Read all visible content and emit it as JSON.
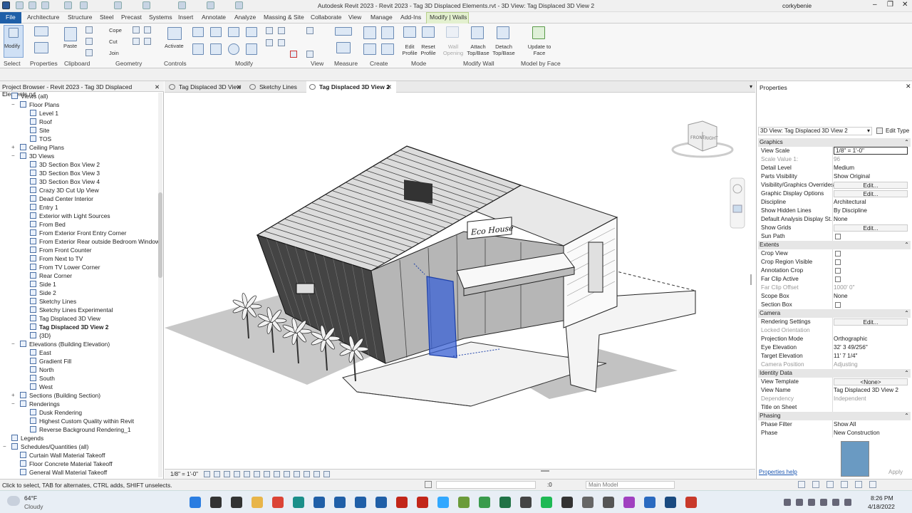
{
  "app": {
    "title": "Autodesk Revit 2023 - Revit 2023 - Tag 3D Displaced Elements.rvt - 3D View: Tag Displaced 3D View 2",
    "user": "corkybenie"
  },
  "ribbon_tabs": [
    "File",
    "Architecture",
    "Structure",
    "Steel",
    "Precast",
    "Systems",
    "Insert",
    "Annotate",
    "Analyze",
    "Massing & Site",
    "Collaborate",
    "View",
    "Manage",
    "Add-Ins",
    "Modify | Walls"
  ],
  "ribbon": {
    "modify": "Modify",
    "paste": "Paste",
    "cope": "Cope",
    "cut": "Cut",
    "join": "Join",
    "activate": "Activate",
    "edit_profile": "Edit Profile",
    "reset_profile": "Reset Profile",
    "wall_opening": "Wall Opening",
    "attach": "Attach Top/Base",
    "detach": "Detach Top/Base",
    "update": "Update to Face",
    "groups": {
      "select": "Select",
      "properties": "Properties",
      "clipboard": "Clipboard",
      "geometry": "Geometry",
      "controls": "Controls",
      "modify": "Modify",
      "view": "View",
      "measure": "Measure",
      "create": "Create",
      "mode": "Mode",
      "modify_wall": "Modify Wall",
      "model_by_face": "Model by Face"
    }
  },
  "project_browser": {
    "title": "Project Browser - Revit 2023 - Tag 3D Displaced Elements.rvt",
    "items": [
      {
        "label": "Views (all)",
        "level": 0,
        "tog": "−"
      },
      {
        "label": "Floor Plans",
        "level": 1,
        "tog": "−"
      },
      {
        "label": "Level 1",
        "level": 2
      },
      {
        "label": "Roof",
        "level": 2
      },
      {
        "label": "Site",
        "level": 2
      },
      {
        "label": "TOS",
        "level": 2
      },
      {
        "label": "Ceiling Plans",
        "level": 1,
        "tog": "+"
      },
      {
        "label": "3D Views",
        "level": 1,
        "tog": "−"
      },
      {
        "label": "3D Section Box View 2",
        "level": 2
      },
      {
        "label": "3D Section Box View 3",
        "level": 2
      },
      {
        "label": "3D Section Box View 4",
        "level": 2
      },
      {
        "label": "Crazy 3D Cut Up View",
        "level": 2
      },
      {
        "label": "Dead Center Interior",
        "level": 2
      },
      {
        "label": "Entry 1",
        "level": 2
      },
      {
        "label": "Exterior with Light Sources",
        "level": 2
      },
      {
        "label": "From Bed",
        "level": 2
      },
      {
        "label": "From Exterior Front Entry Corner",
        "level": 2
      },
      {
        "label": "From Exterior Rear outside Bedroom Window",
        "level": 2
      },
      {
        "label": "From Front Counter",
        "level": 2
      },
      {
        "label": "From Next to TV",
        "level": 2
      },
      {
        "label": "From TV Lower Corner",
        "level": 2
      },
      {
        "label": "Rear Corner",
        "level": 2
      },
      {
        "label": "Side 1",
        "level": 2
      },
      {
        "label": "Side 2",
        "level": 2
      },
      {
        "label": "Sketchy Lines",
        "level": 2
      },
      {
        "label": "Sketchy Lines Experimental",
        "level": 2
      },
      {
        "label": "Tag Displaced 3D View",
        "level": 2
      },
      {
        "label": "Tag Displaced 3D View 2",
        "level": 2,
        "bold": true
      },
      {
        "label": "{3D}",
        "level": 2
      },
      {
        "label": "Elevations (Building Elevation)",
        "level": 1,
        "tog": "−"
      },
      {
        "label": "East",
        "level": 2
      },
      {
        "label": "Gradient Fill",
        "level": 2
      },
      {
        "label": "North",
        "level": 2
      },
      {
        "label": "South",
        "level": 2
      },
      {
        "label": "West",
        "level": 2
      },
      {
        "label": "Sections (Building Section)",
        "level": 1,
        "tog": "+"
      },
      {
        "label": "Renderings",
        "level": 1,
        "tog": "−"
      },
      {
        "label": "Dusk Rendering",
        "level": 2
      },
      {
        "label": "Highest Custom Quality within Revit",
        "level": 2
      },
      {
        "label": "Reverse Background Rendering_1",
        "level": 2
      },
      {
        "label": "Legends",
        "level": 0
      },
      {
        "label": "Schedules/Quantities (all)",
        "level": 0,
        "tog": "−"
      },
      {
        "label": "Curtain Wall Material Takeoff",
        "level": 1
      },
      {
        "label": "Floor Concrete Material Takeoff",
        "level": 1
      },
      {
        "label": "General Wall Material Takeoff",
        "level": 1
      }
    ]
  },
  "view_tabs": [
    {
      "label": "Tag Displaced 3D View"
    },
    {
      "label": "Sketchy Lines"
    },
    {
      "label": "Tag Displaced 3D View 2",
      "active": true
    }
  ],
  "canvas": {
    "sign": "Eco House",
    "cube_front": "FRONT",
    "cube_right": "RIGHT"
  },
  "view_control": {
    "scale": "1/8\" = 1'-0\""
  },
  "properties": {
    "title": "Properties",
    "type": "3D View: Tag Displaced 3D View 2",
    "edit_type": "Edit Type",
    "rows": [
      {
        "sec": "Graphics"
      },
      {
        "k": "View Scale",
        "v": "1/8\" = 1'-0\""
      },
      {
        "k": "Scale Value    1:",
        "v": "96",
        "dis": true
      },
      {
        "k": "Detail Level",
        "v": "Medium"
      },
      {
        "k": "Parts Visibility",
        "v": "Show Original"
      },
      {
        "k": "Visibility/Graphics Overrides",
        "e": "Edit..."
      },
      {
        "k": "Graphic Display Options",
        "e": "Edit..."
      },
      {
        "k": "Discipline",
        "v": "Architectural"
      },
      {
        "k": "Show Hidden Lines",
        "v": "By Discipline"
      },
      {
        "k": "Default Analysis Display St...",
        "v": "None"
      },
      {
        "k": "Show Grids",
        "e": "Edit..."
      },
      {
        "k": "Sun Path",
        "cb": true
      },
      {
        "sec": "Extents"
      },
      {
        "k": "Crop View",
        "cb": true
      },
      {
        "k": "Crop Region Visible",
        "cb": true
      },
      {
        "k": "Annotation Crop",
        "cb": true
      },
      {
        "k": "Far Clip Active",
        "cb": true
      },
      {
        "k": "Far Clip Offset",
        "v": "1000' 0\"",
        "dis": true
      },
      {
        "k": "Scope Box",
        "v": "None"
      },
      {
        "k": "Section Box",
        "cb": true
      },
      {
        "sec": "Camera"
      },
      {
        "k": "Rendering Settings",
        "e": "Edit..."
      },
      {
        "k": "Locked Orientation",
        "dis": true
      },
      {
        "k": "Projection Mode",
        "v": "Orthographic"
      },
      {
        "k": "Eye Elevation",
        "v": "32' 3 49/256\""
      },
      {
        "k": "Target Elevation",
        "v": "11' 7 1/4\""
      },
      {
        "k": "Camera Position",
        "v": "Adjusting",
        "dis": true
      },
      {
        "sec": "Identity Data"
      },
      {
        "k": "View Template",
        "e": "<None>"
      },
      {
        "k": "View Name",
        "v": "Tag Displaced 3D View 2"
      },
      {
        "k": "Dependency",
        "v": "Independent",
        "dis": true
      },
      {
        "k": "Title on Sheet",
        "v": ""
      },
      {
        "sec": "Phasing"
      },
      {
        "k": "Phase Filter",
        "v": "Show All"
      },
      {
        "k": "Phase",
        "v": "New Construction"
      }
    ],
    "help": "Properties help",
    "apply": "Apply"
  },
  "status": {
    "text": "Click to select, TAB for alternates, CTRL adds, SHIFT unselects.",
    "zero": ":0",
    "model": "Main Model"
  },
  "taskbar": {
    "temp": "64°F",
    "weather": "Cloudy",
    "time": "8:26 PM",
    "date": "4/18/2022"
  }
}
